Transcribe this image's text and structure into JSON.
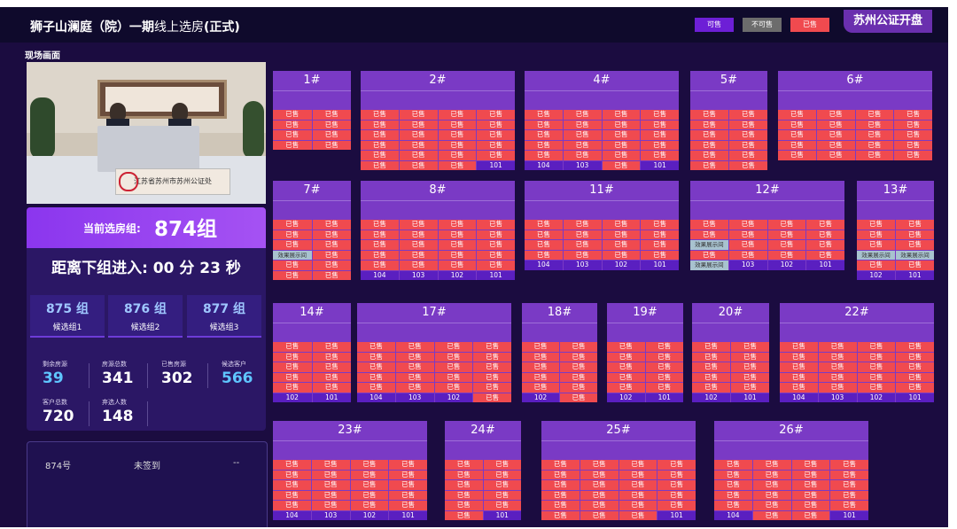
{
  "header": {
    "title_bold": "狮子山澜庭（院）一期",
    "title_thin": "线上选房",
    "title_suffix": "(正式)",
    "legend": {
      "available": "可售",
      "unavailable": "不可售",
      "sold": "已售"
    },
    "notary": "苏州公证开盘"
  },
  "live": {
    "label": "现场画面",
    "sign": "江苏省苏州市苏州公证处"
  },
  "current": {
    "label": "当前选房组:",
    "value": "874组",
    "countdown": "距离下组进入: 00 分 23 秒"
  },
  "candidates": [
    {
      "num": "875 组",
      "label": "候选组1"
    },
    {
      "num": "876 组",
      "label": "候选组2"
    },
    {
      "num": "877 组",
      "label": "候选组3"
    }
  ],
  "stats": {
    "remaining": {
      "label": "剩余房源",
      "value": "39"
    },
    "total": {
      "label": "房源总数",
      "value": "341"
    },
    "sold": {
      "label": "已售房源",
      "value": "302"
    },
    "candidate_clients": {
      "label": "候选客户",
      "value": "566"
    },
    "clients_total": {
      "label": "客户总数",
      "value": "720"
    },
    "abandoned": {
      "label": "弃选人数",
      "value": "148"
    }
  },
  "queue": {
    "no": "874号",
    "status": "未签到",
    "extra": "--"
  },
  "colors": {
    "sold": "#f04a4f",
    "available": "#6d1fd6",
    "unavailable": "#6c6c6c",
    "display": "#a8c2cf"
  },
  "buildings": [
    {
      "name": "1#",
      "cols": 2,
      "rows": [
        [
          "已售",
          "已售"
        ],
        [
          "已售",
          "已售"
        ],
        [
          "已售",
          "已售"
        ],
        [
          "已售",
          "已售"
        ]
      ]
    },
    {
      "name": "2#",
      "cols": 4,
      "rows": [
        [
          "已售",
          "已售",
          "已售",
          "已售"
        ],
        [
          "已售",
          "已售",
          "已售",
          "已售"
        ],
        [
          "已售",
          "已售",
          "已售",
          "已售"
        ],
        [
          "已售",
          "已售",
          "已售",
          "已售"
        ],
        [
          "已售",
          "已售",
          "已售",
          "已售"
        ],
        [
          "已售",
          "已售",
          "已售",
          "101"
        ]
      ]
    },
    {
      "name": "4#",
      "cols": 4,
      "rows": [
        [
          "已售",
          "已售",
          "已售",
          "已售"
        ],
        [
          "已售",
          "已售",
          "已售",
          "已售"
        ],
        [
          "已售",
          "已售",
          "已售",
          "已售"
        ],
        [
          "已售",
          "已售",
          "已售",
          "已售"
        ],
        [
          "已售",
          "已售",
          "已售",
          "已售"
        ],
        [
          "104",
          "103",
          "已售",
          "101"
        ]
      ]
    },
    {
      "name": "5#",
      "cols": 2,
      "rows": [
        [
          "已售",
          "已售"
        ],
        [
          "已售",
          "已售"
        ],
        [
          "已售",
          "已售"
        ],
        [
          "已售",
          "已售"
        ],
        [
          "已售",
          "已售"
        ],
        [
          "已售",
          "已售"
        ]
      ]
    },
    {
      "name": "6#",
      "cols": 4,
      "rows": [
        [
          "已售",
          "已售",
          "已售",
          "已售"
        ],
        [
          "已售",
          "已售",
          "已售",
          "已售"
        ],
        [
          "已售",
          "已售",
          "已售",
          "已售"
        ],
        [
          "已售",
          "已售",
          "已售",
          "已售"
        ],
        [
          "已售",
          "已售",
          "已售",
          "已售"
        ]
      ]
    },
    {
      "name": "7#",
      "cols": 2,
      "rows": [
        [
          "已售",
          "已售"
        ],
        [
          "已售",
          "已售"
        ],
        [
          "已售",
          "已售"
        ],
        [
          "效果展示间",
          "已售"
        ],
        [
          "已售",
          "已售"
        ],
        [
          "已售",
          "已售"
        ]
      ]
    },
    {
      "name": "8#",
      "cols": 4,
      "rows": [
        [
          "已售",
          "已售",
          "已售",
          "已售"
        ],
        [
          "已售",
          "已售",
          "已售",
          "已售"
        ],
        [
          "已售",
          "已售",
          "已售",
          "已售"
        ],
        [
          "已售",
          "已售",
          "已售",
          "已售"
        ],
        [
          "已售",
          "已售",
          "已售",
          "已售"
        ],
        [
          "104",
          "103",
          "102",
          "101"
        ]
      ]
    },
    {
      "name": "11#",
      "cols": 4,
      "rows": [
        [
          "已售",
          "已售",
          "已售",
          "已售"
        ],
        [
          "已售",
          "已售",
          "已售",
          "已售"
        ],
        [
          "已售",
          "已售",
          "已售",
          "已售"
        ],
        [
          "已售",
          "已售",
          "已售",
          "已售"
        ],
        [
          "104",
          "103",
          "102",
          "101"
        ]
      ]
    },
    {
      "name": "12#",
      "cols": 4,
      "rows": [
        [
          "已售",
          "已售",
          "已售",
          "已售"
        ],
        [
          "已售",
          "已售",
          "已售",
          "已售"
        ],
        [
          "效果展示间",
          "已售",
          "已售",
          "已售"
        ],
        [
          "已售",
          "已售",
          "已售",
          "已售"
        ],
        [
          "效果展示间",
          "103",
          "102",
          "101"
        ]
      ]
    },
    {
      "name": "13#",
      "cols": 2,
      "rows": [
        [
          "已售",
          "已售"
        ],
        [
          "已售",
          "已售"
        ],
        [
          "已售",
          "已售"
        ],
        [
          "效果展示间",
          "效果展示间"
        ],
        [
          "已售",
          "已售"
        ],
        [
          "102",
          "101"
        ]
      ]
    },
    {
      "name": "14#",
      "cols": 2,
      "rows": [
        [
          "已售",
          "已售"
        ],
        [
          "已售",
          "已售"
        ],
        [
          "已售",
          "已售"
        ],
        [
          "已售",
          "已售"
        ],
        [
          "已售",
          "已售"
        ],
        [
          "102",
          "101"
        ]
      ]
    },
    {
      "name": "17#",
      "cols": 4,
      "rows": [
        [
          "已售",
          "已售",
          "已售",
          "已售"
        ],
        [
          "已售",
          "已售",
          "已售",
          "已售"
        ],
        [
          "已售",
          "已售",
          "已售",
          "已售"
        ],
        [
          "已售",
          "已售",
          "已售",
          "已售"
        ],
        [
          "已售",
          "已售",
          "已售",
          "已售"
        ],
        [
          "104",
          "103",
          "102",
          "已售"
        ]
      ]
    },
    {
      "name": "18#",
      "cols": 2,
      "rows": [
        [
          "已售",
          "已售"
        ],
        [
          "已售",
          "已售"
        ],
        [
          "已售",
          "已售"
        ],
        [
          "已售",
          "已售"
        ],
        [
          "已售",
          "已售"
        ],
        [
          "102",
          "已售"
        ]
      ]
    },
    {
      "name": "19#",
      "cols": 2,
      "rows": [
        [
          "已售",
          "已售"
        ],
        [
          "已售",
          "已售"
        ],
        [
          "已售",
          "已售"
        ],
        [
          "已售",
          "已售"
        ],
        [
          "已售",
          "已售"
        ],
        [
          "102",
          "101"
        ]
      ]
    },
    {
      "name": "20#",
      "cols": 2,
      "rows": [
        [
          "已售",
          "已售"
        ],
        [
          "已售",
          "已售"
        ],
        [
          "已售",
          "已售"
        ],
        [
          "已售",
          "已售"
        ],
        [
          "已售",
          "已售"
        ],
        [
          "102",
          "101"
        ]
      ]
    },
    {
      "name": "22#",
      "cols": 4,
      "rows": [
        [
          "已售",
          "已售",
          "已售",
          "已售"
        ],
        [
          "已售",
          "已售",
          "已售",
          "已售"
        ],
        [
          "已售",
          "已售",
          "已售",
          "已售"
        ],
        [
          "已售",
          "已售",
          "已售",
          "已售"
        ],
        [
          "已售",
          "已售",
          "已售",
          "已售"
        ],
        [
          "104",
          "103",
          "102",
          "101"
        ]
      ]
    },
    {
      "name": "23#",
      "cols": 4,
      "rows": [
        [
          "已售",
          "已售",
          "已售",
          "已售"
        ],
        [
          "已售",
          "已售",
          "已售",
          "已售"
        ],
        [
          "已售",
          "已售",
          "已售",
          "已售"
        ],
        [
          "已售",
          "已售",
          "已售",
          "已售"
        ],
        [
          "已售",
          "已售",
          "已售",
          "已售"
        ],
        [
          "104",
          "103",
          "102",
          "101"
        ]
      ]
    },
    {
      "name": "24#",
      "cols": 2,
      "rows": [
        [
          "已售",
          "已售"
        ],
        [
          "已售",
          "已售"
        ],
        [
          "已售",
          "已售"
        ],
        [
          "已售",
          "已售"
        ],
        [
          "已售",
          "已售"
        ],
        [
          "已售",
          "101"
        ]
      ]
    },
    {
      "name": "25#",
      "cols": 4,
      "rows": [
        [
          "已售",
          "已售",
          "已售",
          "已售"
        ],
        [
          "已售",
          "已售",
          "已售",
          "已售"
        ],
        [
          "已售",
          "已售",
          "已售",
          "已售"
        ],
        [
          "已售",
          "已售",
          "已售",
          "已售"
        ],
        [
          "已售",
          "已售",
          "已售",
          "已售"
        ],
        [
          "已售",
          "已售",
          "已售",
          "101"
        ]
      ]
    },
    {
      "name": "26#",
      "cols": 4,
      "rows": [
        [
          "已售",
          "已售",
          "已售",
          "已售"
        ],
        [
          "已售",
          "已售",
          "已售",
          "已售"
        ],
        [
          "已售",
          "已售",
          "已售",
          "已售"
        ],
        [
          "已售",
          "已售",
          "已售",
          "已售"
        ],
        [
          "已售",
          "已售",
          "已售",
          "已售"
        ],
        [
          "104",
          "已售",
          "已售",
          "101"
        ]
      ]
    }
  ]
}
